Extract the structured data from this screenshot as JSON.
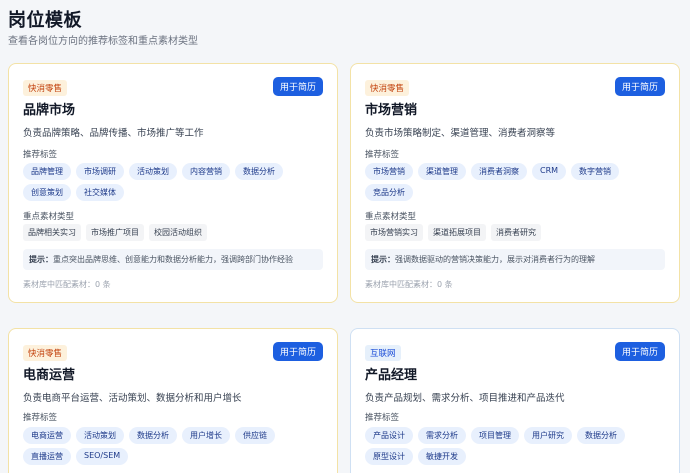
{
  "page": {
    "title": "岗位模板",
    "subtitle": "查看各岗位方向的推荐标签和重点素材类型"
  },
  "labels": {
    "use_button": "用于简历",
    "tags_heading": "推荐标签",
    "materials_heading": "重点素材类型",
    "tip_prefix": "提示：",
    "match_prefix": "素材库中匹配素材："
  },
  "cards": [
    {
      "category": "快消零售",
      "title": "品牌市场",
      "description": "负责品牌策略、品牌传播、市场推广等工作",
      "tags": [
        "品牌管理",
        "市场调研",
        "活动策划",
        "内容营销",
        "数据分析",
        "创意策划",
        "社交媒体"
      ],
      "materials": [
        "品牌相关实习",
        "市场推广项目",
        "校园活动组织"
      ],
      "tip": "重点突出品牌思维、创意能力和数据分析能力，强调跨部门协作经验",
      "match_count": "0 条"
    },
    {
      "category": "快消零售",
      "title": "市场营销",
      "description": "负责市场策略制定、渠道管理、消费者洞察等",
      "tags": [
        "市场营销",
        "渠道管理",
        "消费者洞察",
        "CRM",
        "数字营销",
        "竞品分析"
      ],
      "materials": [
        "市场营销实习",
        "渠道拓展项目",
        "消费者研究"
      ],
      "tip": "强调数据驱动的营销决策能力，展示对消费者行为的理解",
      "match_count": "0 条"
    },
    {
      "category": "快消零售",
      "title": "电商运营",
      "description": "负责电商平台运营、活动策划、数据分析和用户增长",
      "tags": [
        "电商运营",
        "活动策划",
        "数据分析",
        "用户增长",
        "供应链",
        "直播运营",
        "SEO/SEM"
      ]
    },
    {
      "category": "互联网",
      "title": "产品经理",
      "description": "负责产品规划、需求分析、项目推进和产品迭代",
      "tags": [
        "产品设计",
        "需求分析",
        "项目管理",
        "用户研究",
        "数据分析",
        "原型设计",
        "敏捷开发"
      ]
    }
  ]
}
